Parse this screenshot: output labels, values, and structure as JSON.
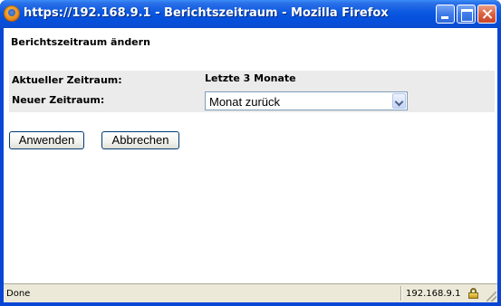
{
  "window": {
    "title": "https://192.168.9.1 - Berichtszeitraum - Mozilla Firefox",
    "icon": "firefox-icon",
    "accent_color": "#0a58e0"
  },
  "dialog": {
    "heading": "Berichtszeitraum ändern",
    "current_label": "Aktueller Zeitraum:",
    "current_value": "Letzte 3 Monate",
    "new_label": "Neuer Zeitraum:",
    "new_selected": "Monat zurück"
  },
  "buttons": {
    "apply": "Anwenden",
    "cancel": "Abbrechen"
  },
  "statusbar": {
    "status": "Done",
    "host": "192.168.9.1",
    "icon": "lock-icon"
  }
}
